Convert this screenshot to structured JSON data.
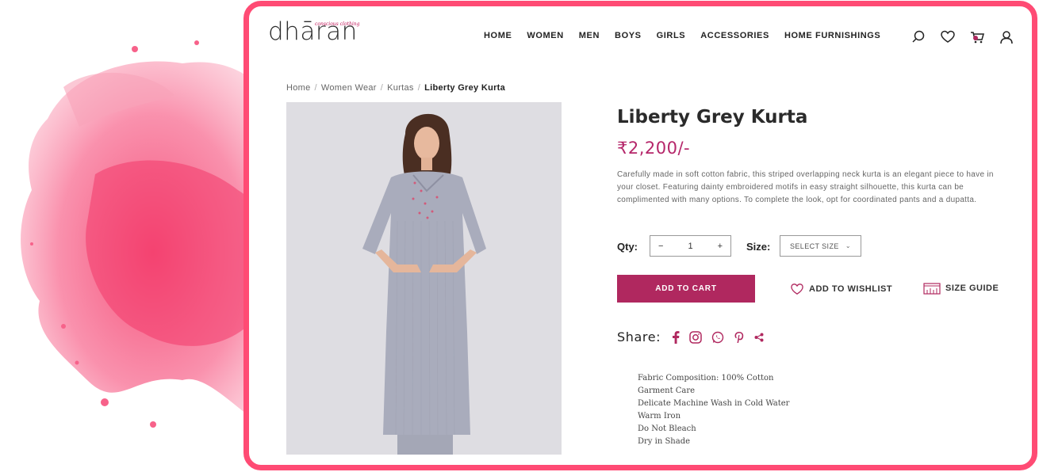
{
  "brand": {
    "logo_text": "dhāran",
    "tagline": "conscious clothing"
  },
  "nav": {
    "items": [
      "HOME",
      "WOMEN",
      "MEN",
      "BOYS",
      "GIRLS",
      "ACCESSORIES",
      "HOME FURNISHINGS"
    ]
  },
  "header_icons": [
    "search-icon",
    "heart-icon",
    "cart-icon",
    "user-icon"
  ],
  "breadcrumb": {
    "items": [
      "Home",
      "Women Wear",
      "Kurtas"
    ],
    "current": "Liberty Grey Kurta"
  },
  "product": {
    "title": "Liberty Grey Kurta",
    "price": "₹2,200/-",
    "description": "Carefully made in soft cotton fabric, this striped overlapping neck kurta is an elegant piece to have in your closet. Featuring dainty embroidered motifs in easy straight silhouette, this kurta can be complimented with many options. To complete the look, opt for coordinated pants and a dupatta.",
    "qty_label": "Qty:",
    "qty_value": "1",
    "qty_minus": "−",
    "qty_plus": "+",
    "size_label": "Size:",
    "size_placeholder": "SELECT SIZE",
    "add_to_cart": "ADD TO CART",
    "wishlist": "ADD TO WISHLIST",
    "size_guide": "SIZE GUIDE",
    "share_label": "Share:",
    "share_icons": [
      "facebook-icon",
      "instagram-icon",
      "whatsapp-icon",
      "pinterest-icon",
      "share-icon"
    ],
    "specs": [
      "Fabric Composition: 100% Cotton",
      "Garment Care",
      "Delicate Machine Wash in Cold Water",
      "Warm Iron",
      "Do Not Bleach",
      "Dry in Shade"
    ]
  },
  "colors": {
    "accent": "#b0285f",
    "price": "#b5266a",
    "frame": "#ff4b74",
    "splash": "#f6476f"
  }
}
